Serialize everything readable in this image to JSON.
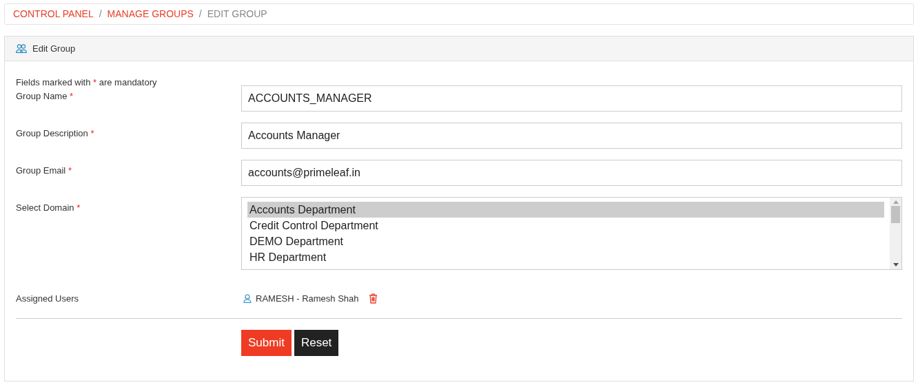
{
  "breadcrumb": [
    {
      "label": "CONTROL PANEL",
      "link": true
    },
    {
      "label": "MANAGE GROUPS",
      "link": true
    },
    {
      "label": "EDIT GROUP",
      "link": false
    }
  ],
  "breadcrumb_separator": "/",
  "panel": {
    "title": "Edit Group",
    "note": {
      "before": "Fields marked with",
      "mark": "*",
      "after": "are mandatory"
    },
    "fields": [
      {
        "kind": "text",
        "label": "Group Name",
        "required_mark": "*",
        "value": "ACCOUNTS_MANAGER"
      },
      {
        "kind": "text",
        "label": "Group Description",
        "required_mark": "*",
        "value": "Accounts Manager"
      },
      {
        "kind": "text",
        "label": "Group Email",
        "required_mark": "*",
        "value": "accounts@primeleaf.in"
      },
      {
        "kind": "listbox",
        "label": "Select Domain",
        "required_mark": "*",
        "options": [
          {
            "label": "Accounts Department",
            "selected": true
          },
          {
            "label": "Credit Control Department",
            "selected": false
          },
          {
            "label": "DEMO Department",
            "selected": false
          },
          {
            "label": "HR Department",
            "selected": false
          }
        ]
      },
      {
        "kind": "users",
        "label": "Assigned Users",
        "users": [
          "RAMESH - Ramesh Shah"
        ]
      }
    ],
    "buttons": [
      {
        "kind": "primary",
        "label": "Submit"
      },
      {
        "kind": "secondary",
        "label": "Reset"
      }
    ]
  }
}
